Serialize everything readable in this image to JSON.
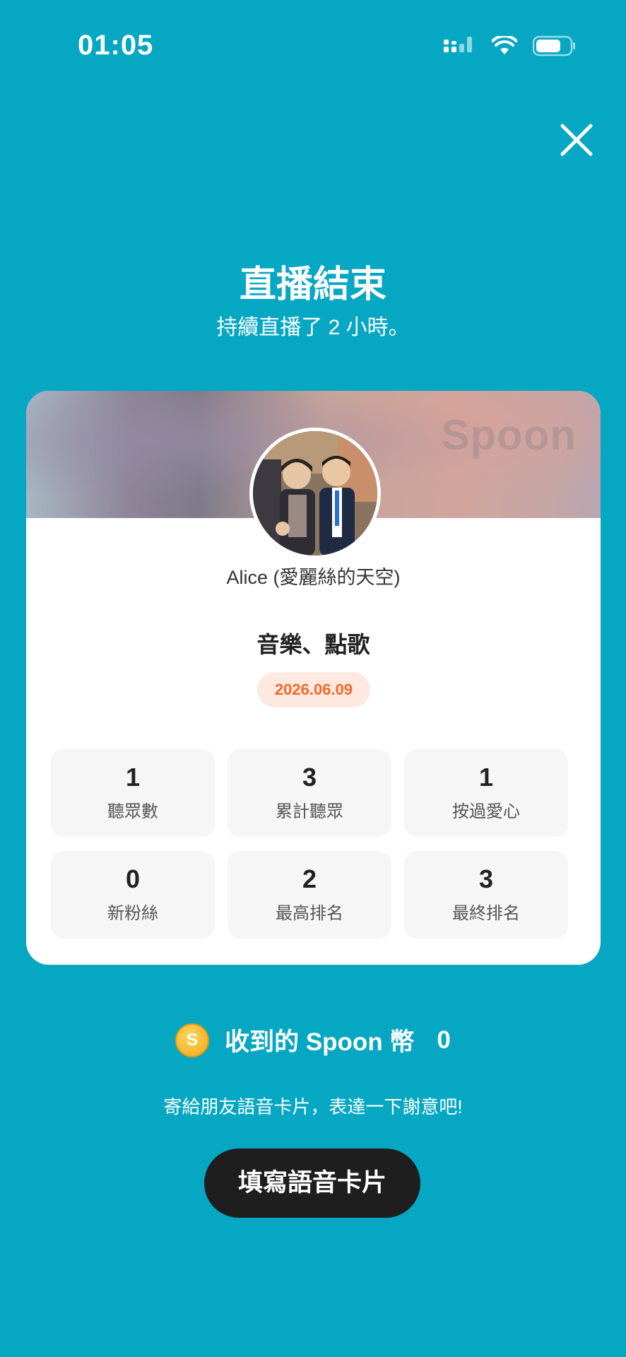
{
  "status_bar": {
    "time": "01:05",
    "icons": [
      "signal-icon",
      "wifi-icon",
      "battery-icon"
    ]
  },
  "header": {
    "close_icon": "close-icon",
    "title": "直播結束",
    "subtitle": "持續直播了 2 小時。"
  },
  "card": {
    "watermark": "Spoon",
    "user_name": "Alice (愛麗絲的天空)",
    "room_title": "音樂、點歌",
    "date": "2026.06.09",
    "stats": [
      {
        "value": "1",
        "label": "聽眾數"
      },
      {
        "value": "3",
        "label": "累計聽眾"
      },
      {
        "value": "1",
        "label": "按過愛心"
      },
      {
        "value": "0",
        "label": "新粉絲"
      },
      {
        "value": "2",
        "label": "最高排名"
      },
      {
        "value": "3",
        "label": "最終排名"
      }
    ]
  },
  "coins": {
    "icon": "coin-icon",
    "icon_letter": "S",
    "label": "收到的 Spoon 幣",
    "value": "0"
  },
  "footer": {
    "thanks_text": "寄給朋友語音卡片，表達一下謝意吧!",
    "button_label": "填寫語音卡片"
  },
  "colors": {
    "background": "#05a7c3",
    "date_badge_text": "#f26a2e",
    "date_badge_bg": "#fde9e0",
    "button_bg": "#1e1e1e"
  }
}
